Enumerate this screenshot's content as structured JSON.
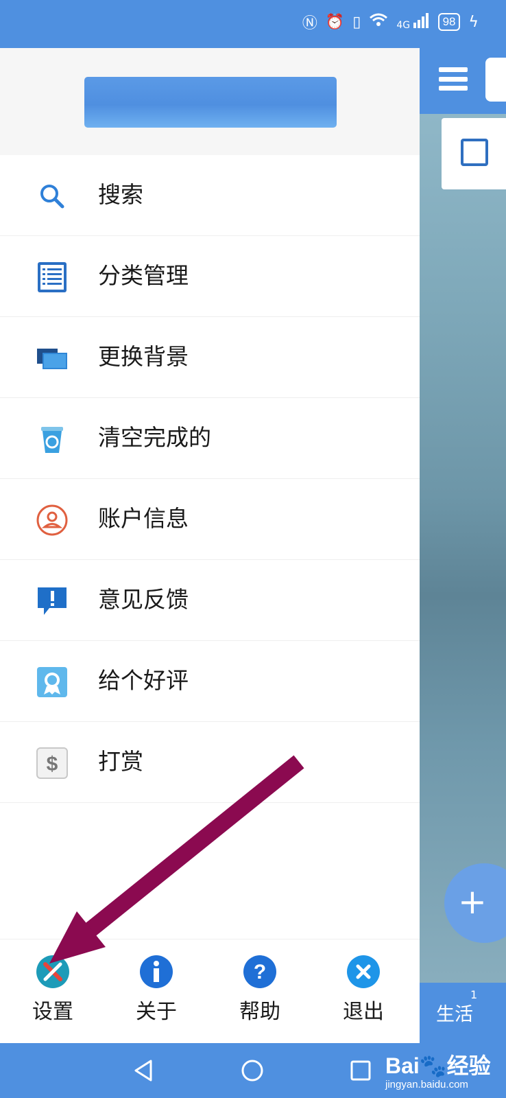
{
  "status_bar": {
    "battery": "98",
    "network": "4G"
  },
  "drawer": {
    "menu": [
      {
        "id": "search",
        "label": "搜索",
        "icon": "search-icon"
      },
      {
        "id": "categories",
        "label": "分类管理",
        "icon": "list-icon"
      },
      {
        "id": "background",
        "label": "更换背景",
        "icon": "screens-icon"
      },
      {
        "id": "clear",
        "label": "清空完成的",
        "icon": "recycle-bin-icon"
      },
      {
        "id": "account",
        "label": "账户信息",
        "icon": "user-circle-icon"
      },
      {
        "id": "feedback",
        "label": "意见反馈",
        "icon": "feedback-icon"
      },
      {
        "id": "rate",
        "label": "给个好评",
        "icon": "award-icon"
      },
      {
        "id": "tip",
        "label": "打赏",
        "icon": "dollar-icon"
      }
    ],
    "bottom": [
      {
        "id": "settings",
        "label": "设置",
        "icon": "tools-icon"
      },
      {
        "id": "about",
        "label": "关于",
        "icon": "info-icon"
      },
      {
        "id": "help",
        "label": "帮助",
        "icon": "help-icon"
      },
      {
        "id": "exit",
        "label": "退出",
        "icon": "close-icon"
      }
    ]
  },
  "background_app": {
    "bottom_tab": "生活",
    "badge": "1",
    "fab": "+"
  },
  "watermark": {
    "brand": "Bai🐾经验",
    "url": "jingyan.baidu.com"
  },
  "colors": {
    "primary": "#4f90e0",
    "annotation": "#8b0a50"
  }
}
